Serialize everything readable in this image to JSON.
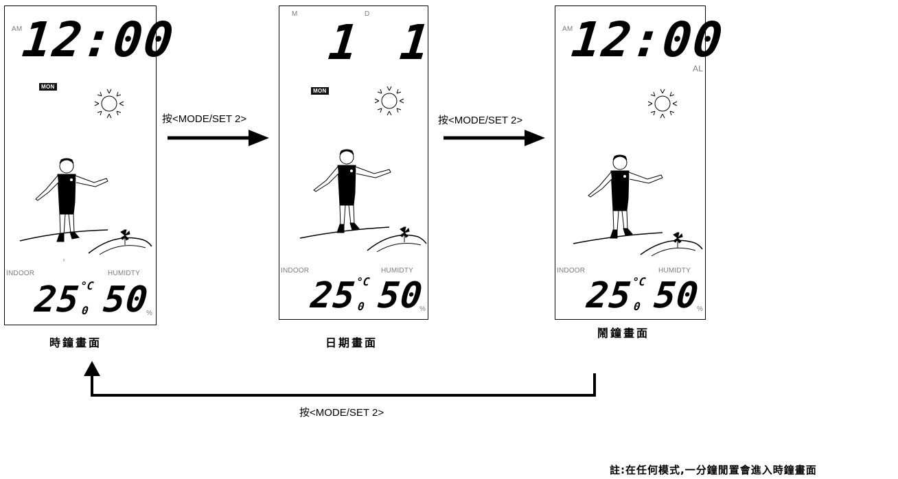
{
  "panels": [
    {
      "ampm": "AM",
      "main_digits": "12:00",
      "day": "MON",
      "indoor_label": "INDOOR",
      "humidity_label": "HUMIDTY",
      "temp_int": "25",
      "temp_dec": "0",
      "temp_unit": "°C",
      "humidity_value": "50",
      "humidity_unit": "%",
      "caption": "時鐘畫面"
    },
    {
      "month_label": "M",
      "date_label": "D",
      "month_value": "1",
      "date_value": "1",
      "day": "MON",
      "indoor_label": "INDOOR",
      "humidity_label": "HUMIDTY",
      "temp_int": "25",
      "temp_dec": "0",
      "temp_unit": "°C",
      "humidity_value": "50",
      "humidity_unit": "%",
      "caption": "日期畫面"
    },
    {
      "ampm": "AM",
      "main_digits": "12:00",
      "alarm_flag": "AL",
      "indoor_label": "INDOOR",
      "humidity_label": "HUMIDTY",
      "temp_int": "25",
      "temp_dec": "0",
      "temp_unit": "°C",
      "humidity_value": "50",
      "humidity_unit": "%",
      "caption": "鬧鐘畫面"
    }
  ],
  "arrows": {
    "a1_label": "按<MODE/SET 2>",
    "a2_label": "按<MODE/SET 2>",
    "back_label": "按<MODE/SET 2>"
  },
  "note": "註:在任何模式,一分鐘閒置會進入時鐘畫面"
}
